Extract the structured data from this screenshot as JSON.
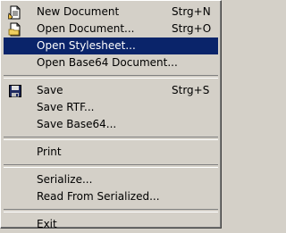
{
  "menu": {
    "items": [
      {
        "label": "New Document",
        "shortcut": "Strg+N",
        "icon": "new-document-icon"
      },
      {
        "label": "Open Document...",
        "shortcut": "Strg+O",
        "icon": "open-document-icon"
      },
      {
        "label": "Open Stylesheet...",
        "shortcut": ""
      },
      {
        "label": "Open Base64 Document...",
        "shortcut": ""
      },
      {
        "label": "Save",
        "shortcut": "Strg+S",
        "icon": "save-disk-icon"
      },
      {
        "label": "Save RTF...",
        "shortcut": ""
      },
      {
        "label": "Save Base64...",
        "shortcut": ""
      },
      {
        "label": "Print",
        "shortcut": ""
      },
      {
        "label": "Serialize...",
        "shortcut": ""
      },
      {
        "label": "Read From Serialized...",
        "shortcut": ""
      },
      {
        "label": "Exit",
        "shortcut": ""
      }
    ],
    "highlighted_index": 2
  },
  "colors": {
    "menu_bg": "#d4d0c8",
    "highlight_bg": "#0a246a",
    "highlight_text": "#ffffff",
    "text": "#000000"
  }
}
